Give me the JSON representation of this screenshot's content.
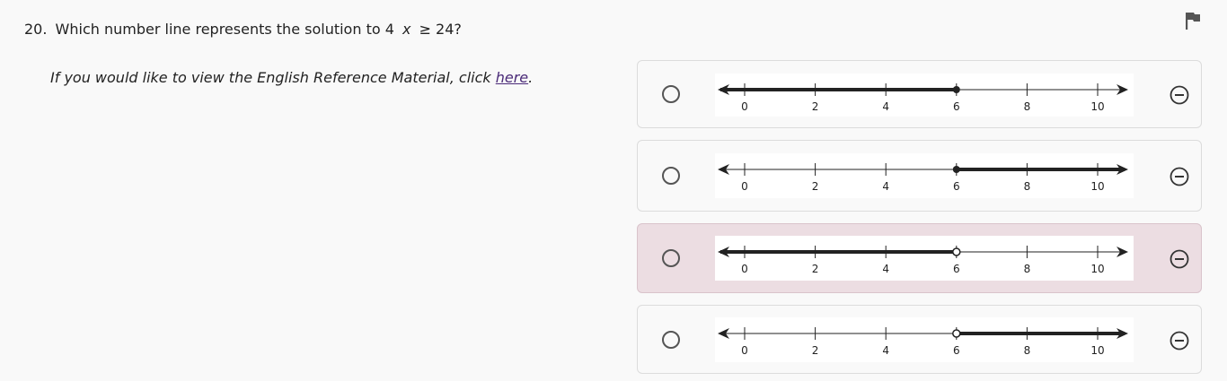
{
  "question": {
    "number": "20.",
    "text_before": "Which number line represents the solution to 4",
    "variable": "x",
    "text_after": "≥ 24?"
  },
  "reference": {
    "text_before": "If you would like to view the English Reference Material, click",
    "link_text": "here",
    "text_after": "."
  },
  "icons": {
    "flag": "flag-icon",
    "eliminate": "eliminate-icon",
    "radio": "radio-icon"
  },
  "tick_labels": [
    "0",
    "2",
    "4",
    "6",
    "8",
    "10"
  ],
  "options": [
    {
      "shaded": "left",
      "point": 6,
      "endpoint": "closed",
      "highlighted": false
    },
    {
      "shaded": "right",
      "point": 6,
      "endpoint": "closed",
      "highlighted": false
    },
    {
      "shaded": "left",
      "point": 6,
      "endpoint": "open",
      "highlighted": true
    },
    {
      "shaded": "right",
      "point": 6,
      "endpoint": "open",
      "highlighted": false
    }
  ],
  "colors": {
    "background": "#f9f9f9",
    "highlight": "#ecdde2",
    "link": "#4a2a78"
  }
}
